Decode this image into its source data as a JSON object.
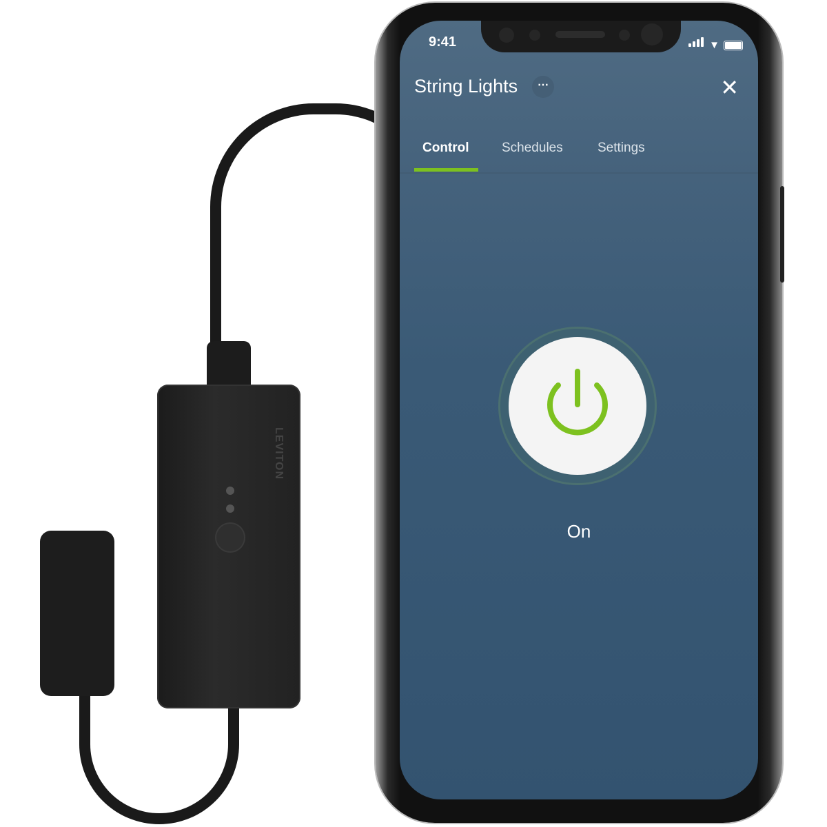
{
  "device": {
    "brand_logo": "LEVITON"
  },
  "status_bar": {
    "time": "9:41",
    "icons": [
      "signal-icon",
      "wifi-icon",
      "battery-icon"
    ]
  },
  "header": {
    "title": "String Lights",
    "more_icon": "ellipsis-icon",
    "close_icon": "close-icon"
  },
  "tabs": [
    {
      "label": "Control",
      "active": true
    },
    {
      "label": "Schedules",
      "active": false
    },
    {
      "label": "Settings",
      "active": false
    }
  ],
  "control": {
    "power_icon": "power-icon",
    "state": "On"
  },
  "colors": {
    "accent": "#7dc11f",
    "background": "#3a5a76",
    "header": "#4f6b83"
  }
}
